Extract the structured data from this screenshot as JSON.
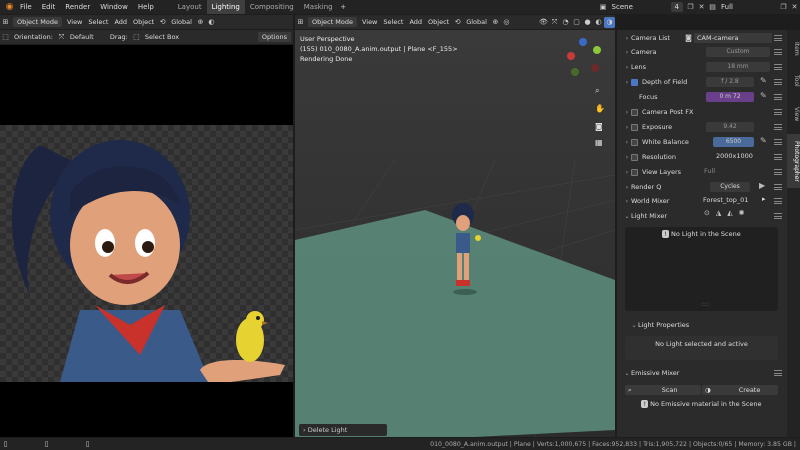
{
  "menu": {
    "file": "File",
    "edit": "Edit",
    "render": "Render",
    "window": "Window",
    "help": "Help"
  },
  "workspaces": [
    {
      "label": "Layout"
    },
    {
      "label": "Lighting"
    },
    {
      "label": "Compositing"
    },
    {
      "label": "Masking"
    }
  ],
  "scene": {
    "name": "Scene",
    "count": "4",
    "view_layer": "Full"
  },
  "left_editor": {
    "mode": "Object Mode",
    "view": "View",
    "select": "Select",
    "add": "Add",
    "object": "Object",
    "orientation_label": "Orientation:",
    "orientation": "Default",
    "drag_label": "Drag:",
    "drag": "Select Box",
    "options": "Options",
    "transform": "Global"
  },
  "viewport": {
    "mode": "Object Mode",
    "view": "View",
    "select": "Select",
    "add": "Add",
    "object": "Object",
    "transform": "Global",
    "overlay_line1": "User Perspective",
    "overlay_line2": "(155) 010_0080_A.anim.output | Plane <F_155>",
    "overlay_line3": "Rendering Done",
    "last_op": "Delete Light"
  },
  "photographer": {
    "camera_list": "Camera List",
    "camera_name": "CAM-camera",
    "camera": "Camera",
    "camera_value": "Custom",
    "lens": "Lens",
    "lens_value": "18 mm",
    "dof": "Depth of Field",
    "dof_value": "f / 2.8",
    "focus": "Focus",
    "focus_value": "0 m 72",
    "post_fx": "Camera Post FX",
    "exposure": "Exposure",
    "exposure_value": "9.42",
    "white_balance": "White Balance",
    "white_balance_value": "6500",
    "resolution": "Resolution",
    "resolution_value": "2000x1000",
    "view_layers": "View Layers",
    "view_layers_value": "Full",
    "render_q": "Render Q",
    "render_engine": "Cycles",
    "world_mixer": "World Mixer",
    "world_value": "Forest_top_01",
    "light_mixer": "Light Mixer",
    "no_light": "No Light in the Scene",
    "light_props": "Light Properties",
    "no_light_sel": "No Light selected and active",
    "emissive_mixer": "Emissive Mixer",
    "scan": "Scan",
    "create": "Create",
    "no_emissive": "No Emissive material in the Scene"
  },
  "side_tabs": {
    "item": "Item",
    "tool": "Tool",
    "view": "View",
    "photographer": "Photographer"
  },
  "status_bar": "010_0080_A.anim.output | Plane | Verts:1,000,675 | Faces:952,833 | Tris:1,905,722 | Objects:0/65 | Memory: 3.85 GB |",
  "colors": {
    "accent_blue": "#4a77c4",
    "active_tab": "#3f3f3f",
    "floor": "#5a8a7a",
    "focus_field": "#6a3f8a"
  }
}
